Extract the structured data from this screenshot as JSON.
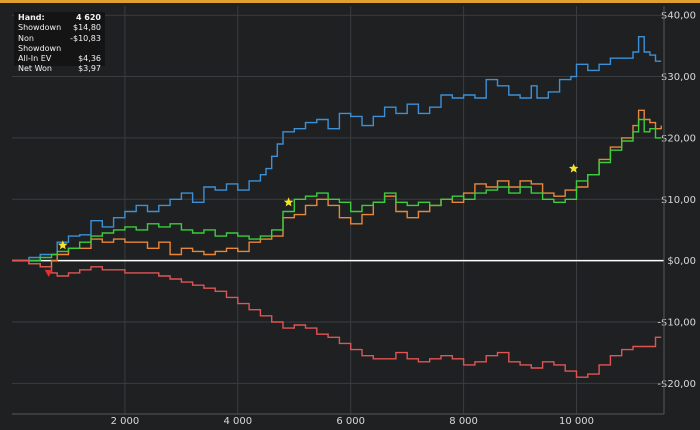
{
  "stats": {
    "rows": [
      {
        "label": "Hand:",
        "value": "4 620"
      },
      {
        "label": "Showdown",
        "value": "$14,80"
      },
      {
        "label": "Non Showdown",
        "value": "-$10,83"
      },
      {
        "label": "All-In EV",
        "value": "$4,36"
      },
      {
        "label": "Net Won",
        "value": "$3,97"
      }
    ]
  },
  "colors": {
    "background": "#1e2022",
    "grid": "#3a3d40",
    "zero_line": "#ffffff",
    "top_border": "#e0a030",
    "marker_star": "#f5e52a",
    "marker_red": "#e03030"
  },
  "chart_data": {
    "type": "line",
    "x_ticks": [
      "2 000",
      "4 000",
      "6 000",
      "8 000",
      "10 000"
    ],
    "y_ticks": [
      "$40,00",
      "$30,00",
      "$20,00",
      "$10,00",
      "$0,00",
      "-$10,00",
      "-$20,00"
    ],
    "y_tick_values": [
      40,
      30,
      20,
      10,
      0,
      -10,
      -20
    ],
    "x_tick_values": [
      2000,
      4000,
      6000,
      8000,
      10000
    ],
    "xlim": [
      0,
      11550
    ],
    "ylim": [
      -25,
      41.5
    ],
    "ylabel": "",
    "grid": true,
    "zero_line": true,
    "series": [
      {
        "color": "#3d8fd6",
        "points": [
          [
            0,
            0
          ],
          [
            300,
            0.5
          ],
          [
            500,
            1
          ],
          [
            800,
            3
          ],
          [
            1000,
            4
          ],
          [
            1200,
            4.2
          ],
          [
            1400,
            6.5
          ],
          [
            1600,
            5.5
          ],
          [
            1800,
            7
          ],
          [
            2000,
            8
          ],
          [
            2200,
            9
          ],
          [
            2400,
            8
          ],
          [
            2600,
            9
          ],
          [
            2800,
            10
          ],
          [
            3000,
            11
          ],
          [
            3200,
            9.5
          ],
          [
            3400,
            12
          ],
          [
            3600,
            11.5
          ],
          [
            3800,
            12.5
          ],
          [
            4000,
            11.5
          ],
          [
            4200,
            13
          ],
          [
            4400,
            14
          ],
          [
            4500,
            15
          ],
          [
            4600,
            17
          ],
          [
            4700,
            19
          ],
          [
            4800,
            21
          ],
          [
            5000,
            21.5
          ],
          [
            5200,
            22.5
          ],
          [
            5400,
            23
          ],
          [
            5600,
            21.5
          ],
          [
            5800,
            24
          ],
          [
            6000,
            23.5
          ],
          [
            6200,
            22
          ],
          [
            6400,
            23.5
          ],
          [
            6600,
            25
          ],
          [
            6800,
            24
          ],
          [
            7000,
            25.5
          ],
          [
            7200,
            24
          ],
          [
            7400,
            25
          ],
          [
            7600,
            27
          ],
          [
            7800,
            26.5
          ],
          [
            8000,
            27
          ],
          [
            8200,
            26.5
          ],
          [
            8400,
            29.5
          ],
          [
            8600,
            28.5
          ],
          [
            8800,
            27
          ],
          [
            9000,
            26.5
          ],
          [
            9200,
            28.5
          ],
          [
            9300,
            26.5
          ],
          [
            9500,
            27.5
          ],
          [
            9700,
            29.5
          ],
          [
            9900,
            30
          ],
          [
            10000,
            32
          ],
          [
            10200,
            31
          ],
          [
            10400,
            32
          ],
          [
            10600,
            33
          ],
          [
            10800,
            33
          ],
          [
            11000,
            34
          ],
          [
            11100,
            36.5
          ],
          [
            11200,
            34
          ],
          [
            11300,
            33.5
          ],
          [
            11400,
            32.5
          ],
          [
            11500,
            32.5
          ]
        ]
      },
      {
        "color": "#e8873a",
        "points": [
          [
            0,
            0
          ],
          [
            300,
            -0.5
          ],
          [
            500,
            -1
          ],
          [
            700,
            0
          ],
          [
            800,
            1
          ],
          [
            1000,
            2
          ],
          [
            1200,
            2
          ],
          [
            1400,
            3.5
          ],
          [
            1600,
            3
          ],
          [
            1800,
            3.5
          ],
          [
            2000,
            3
          ],
          [
            2200,
            3
          ],
          [
            2400,
            2
          ],
          [
            2600,
            3
          ],
          [
            2800,
            1
          ],
          [
            3000,
            2
          ],
          [
            3200,
            1.5
          ],
          [
            3400,
            1
          ],
          [
            3600,
            1.5
          ],
          [
            3800,
            2
          ],
          [
            4000,
            1.5
          ],
          [
            4200,
            3
          ],
          [
            4400,
            3.5
          ],
          [
            4600,
            4
          ],
          [
            4800,
            7
          ],
          [
            5000,
            7.5
          ],
          [
            5200,
            9
          ],
          [
            5400,
            10
          ],
          [
            5600,
            9
          ],
          [
            5800,
            7
          ],
          [
            6000,
            6
          ],
          [
            6200,
            7.5
          ],
          [
            6400,
            9.5
          ],
          [
            6600,
            10.5
          ],
          [
            6800,
            8
          ],
          [
            7000,
            7
          ],
          [
            7200,
            8
          ],
          [
            7400,
            9
          ],
          [
            7600,
            10
          ],
          [
            7800,
            9.5
          ],
          [
            8000,
            11
          ],
          [
            8200,
            12.5
          ],
          [
            8400,
            12
          ],
          [
            8600,
            13
          ],
          [
            8800,
            12
          ],
          [
            9000,
            13
          ],
          [
            9200,
            12.5
          ],
          [
            9400,
            11
          ],
          [
            9600,
            10.5
          ],
          [
            9800,
            11.5
          ],
          [
            10000,
            12
          ],
          [
            10200,
            14
          ],
          [
            10400,
            16.5
          ],
          [
            10600,
            18.5
          ],
          [
            10800,
            20
          ],
          [
            11000,
            22
          ],
          [
            11100,
            24.5
          ],
          [
            11200,
            23
          ],
          [
            11300,
            22.5
          ],
          [
            11400,
            21.5
          ],
          [
            11500,
            22
          ]
        ]
      },
      {
        "color": "#3ccc3c",
        "points": [
          [
            0,
            0
          ],
          [
            300,
            0
          ],
          [
            500,
            0.5
          ],
          [
            700,
            1
          ],
          [
            800,
            1.5
          ],
          [
            1000,
            2
          ],
          [
            1200,
            3
          ],
          [
            1400,
            4
          ],
          [
            1600,
            4.5
          ],
          [
            1800,
            5
          ],
          [
            2000,
            5.5
          ],
          [
            2200,
            5
          ],
          [
            2400,
            6
          ],
          [
            2600,
            5.5
          ],
          [
            2800,
            6
          ],
          [
            3000,
            5
          ],
          [
            3200,
            4.5
          ],
          [
            3400,
            5
          ],
          [
            3600,
            4
          ],
          [
            3800,
            4.5
          ],
          [
            4000,
            4
          ],
          [
            4200,
            3.5
          ],
          [
            4400,
            4
          ],
          [
            4600,
            5
          ],
          [
            4800,
            8
          ],
          [
            5000,
            10
          ],
          [
            5200,
            10.5
          ],
          [
            5400,
            11
          ],
          [
            5600,
            10
          ],
          [
            5800,
            9.5
          ],
          [
            6000,
            8
          ],
          [
            6200,
            9
          ],
          [
            6400,
            9.5
          ],
          [
            6600,
            11
          ],
          [
            6800,
            9.5
          ],
          [
            7000,
            9
          ],
          [
            7200,
            9.5
          ],
          [
            7400,
            9
          ],
          [
            7600,
            10
          ],
          [
            7800,
            10.5
          ],
          [
            8000,
            10
          ],
          [
            8200,
            11
          ],
          [
            8400,
            11.5
          ],
          [
            8600,
            12
          ],
          [
            8800,
            11
          ],
          [
            9000,
            12
          ],
          [
            9200,
            11
          ],
          [
            9400,
            10
          ],
          [
            9600,
            9.5
          ],
          [
            9800,
            10
          ],
          [
            10000,
            13
          ],
          [
            10200,
            14
          ],
          [
            10400,
            16
          ],
          [
            10600,
            18
          ],
          [
            10800,
            19.5
          ],
          [
            11000,
            21
          ],
          [
            11100,
            23
          ],
          [
            11200,
            21
          ],
          [
            11300,
            21.5
          ],
          [
            11400,
            20
          ],
          [
            11500,
            20
          ]
        ]
      },
      {
        "color": "#e05454",
        "points": [
          [
            0,
            0
          ],
          [
            300,
            -0.5
          ],
          [
            500,
            -1
          ],
          [
            700,
            -2
          ],
          [
            800,
            -2.5
          ],
          [
            1000,
            -2
          ],
          [
            1200,
            -1.5
          ],
          [
            1400,
            -1
          ],
          [
            1600,
            -1.5
          ],
          [
            1800,
            -1.5
          ],
          [
            2000,
            -2
          ],
          [
            2200,
            -2
          ],
          [
            2400,
            -2
          ],
          [
            2600,
            -2.5
          ],
          [
            2800,
            -3
          ],
          [
            3000,
            -3.5
          ],
          [
            3200,
            -4
          ],
          [
            3400,
            -4.5
          ],
          [
            3600,
            -5
          ],
          [
            3800,
            -6
          ],
          [
            4000,
            -7
          ],
          [
            4200,
            -8
          ],
          [
            4400,
            -9
          ],
          [
            4600,
            -10
          ],
          [
            4800,
            -11
          ],
          [
            5000,
            -10.5
          ],
          [
            5200,
            -11
          ],
          [
            5400,
            -12
          ],
          [
            5600,
            -12.5
          ],
          [
            5800,
            -13.5
          ],
          [
            6000,
            -14.5
          ],
          [
            6200,
            -15.5
          ],
          [
            6400,
            -16
          ],
          [
            6600,
            -16
          ],
          [
            6800,
            -15
          ],
          [
            7000,
            -16
          ],
          [
            7200,
            -16.5
          ],
          [
            7400,
            -16
          ],
          [
            7600,
            -15.5
          ],
          [
            7800,
            -16
          ],
          [
            8000,
            -17
          ],
          [
            8200,
            -16.5
          ],
          [
            8400,
            -15.5
          ],
          [
            8600,
            -15
          ],
          [
            8800,
            -16.5
          ],
          [
            9000,
            -17
          ],
          [
            9200,
            -17.5
          ],
          [
            9400,
            -16.5
          ],
          [
            9600,
            -17
          ],
          [
            9800,
            -18
          ],
          [
            10000,
            -19
          ],
          [
            10200,
            -18.5
          ],
          [
            10400,
            -17
          ],
          [
            10600,
            -15.5
          ],
          [
            10800,
            -14.5
          ],
          [
            11000,
            -14
          ],
          [
            11200,
            -14
          ],
          [
            11400,
            -12.5
          ],
          [
            11500,
            -12.5
          ]
        ]
      }
    ],
    "markers": [
      {
        "type": "star",
        "x": 900,
        "y": 2.5
      },
      {
        "type": "star",
        "x": 4900,
        "y": 9.5
      },
      {
        "type": "star",
        "x": 9950,
        "y": 15
      },
      {
        "type": "down-triangle",
        "x": 650,
        "y": -2
      }
    ]
  }
}
